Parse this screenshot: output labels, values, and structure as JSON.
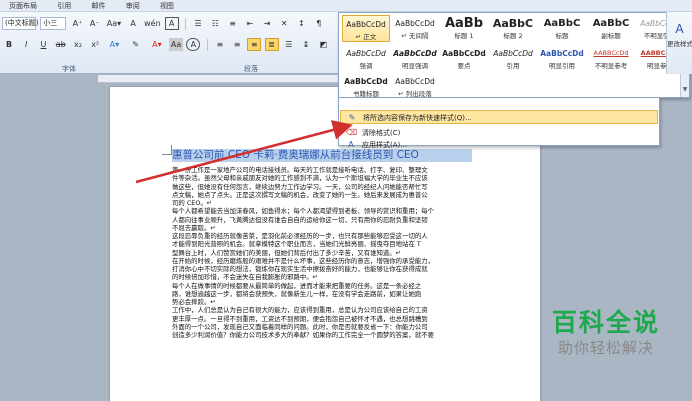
{
  "menubar": {
    "tabs": [
      "页面布局",
      "引用",
      "邮件",
      "审阅",
      "视图"
    ]
  },
  "ribbon": {
    "font_name": "(中文标题)",
    "font_size": "小三",
    "row1_icons": [
      "A⁺",
      "A⁻",
      "Aa▾",
      "A",
      "wén",
      "A"
    ],
    "row2_icons": [
      "ab",
      "A▾",
      "A▾",
      "Aa",
      "A"
    ],
    "font_group_label": "字体",
    "paragraph_group_label": "段落"
  },
  "gallery": {
    "row1": [
      {
        "sample": "AaBbCcDd",
        "name": "↵ 正文"
      },
      {
        "sample": "AaBbCcDd",
        "name": "↵ 无间隔"
      },
      {
        "sample": "AaBb",
        "name": "标题 1"
      },
      {
        "sample": "AaBbC",
        "name": "标题 2"
      },
      {
        "sample": "AaBbC",
        "name": "标题"
      },
      {
        "sample": "AaBbC",
        "name": "副标题"
      },
      {
        "sample": "AaBbCcDd",
        "name": "不明显强调"
      }
    ],
    "row2": [
      {
        "sample": "AaBbCcDd",
        "name": "强调"
      },
      {
        "sample": "AaBbCcDd",
        "name": "明显强调"
      },
      {
        "sample": "AaBbCcDd",
        "name": "要点"
      },
      {
        "sample": "AaBbCcDd",
        "name": "引用"
      },
      {
        "sample": "AaBbCcDd",
        "name": "明显引用"
      },
      {
        "sample": "AABBCcDd",
        "name": "不明显参考"
      },
      {
        "sample": "AABBCcDd",
        "name": "明显参考"
      }
    ],
    "row3": [
      {
        "sample": "AaBbCcDd",
        "name": "书籍标题"
      },
      {
        "sample": "AaBbCcDd",
        "name": "↵ 列出段落"
      }
    ]
  },
  "menu": {
    "save_selection": "将所选内容保存为新快速样式(Q)...",
    "clear_format": "清除格式(C)",
    "apply_styles": "应用样式(A)..."
  },
  "right_panel": {
    "change_styles": "更改样式"
  },
  "document": {
    "title": "惠普公司前 CEO 卡莉·费奥瑞娜从前台接线员到 CEO",
    "lines": [
      "第一份工作是一家地产公司的电话接线员。每天的工作就是接听电话、打字、复印、整理文",
      "件等杂活。虽然父母和亲戚朋友对她的工作感到不满，认为一个斯坦福大学的毕业生不应该",
      "做这些，但她没有任何怨言，继续边努力工作边学习。一天，公司的经纪人问她能否帮忙写",
      "点文稿，她点了点头。正是这次撰写文稿的机会，改变了她的一生。她后来发展成为惠普公",
      "司的 CEO。↵",
      "每个人都希望能去当加沫春风，如鱼得水；每个人都渴望得到老板、领导的赏识和重用；每个",
      "人都向往事业顺升，飞黄腾达但没有谁会自自的运给你这一切，只有用你的忍耐负重和坚韧",
      "不屈去赢取。↵",
      "这段忍辱负重的经历就像苦菜，是羽化前必须经历的一步，也只有那些能够忍受这一切的人",
      "才能得到阳光普照的机会。就拿模特这个职业而言，当她们光鲜亮丽、摇曳夺目地站在 T",
      "型舞台上时，人们赞赏她们的美丽，但她们背后付出了多少辛苦，又有谁知道。↵",
      "在开始的时候，经历磨炼般的艰难并不是什么坏事，这些经历你的意志，增强你的承受能力，",
      "打消你心中不切实际的想法，锻炼你在现实生活中擦拨奋好的能力，也能够让你在获得成就",
      "的时候倍加珍惜，不会迷失在自我膨胀的邪路中。↵",
      "每个人在做事情的时候都要从最简单的做起，进而才能来把重要的任务。这是一条必经之",
      "路，谁想逾越这一步，都将会获预失，就像新生儿一样，在没有学会走路前，如果让她跑",
      "势必会摔跤。↵",
      "工作中，人们总是认为自己有很大的能力，应该得到重用，总是认为公司应该给自己的工资",
      "更丰厚一点。一旦得不到重用，工资达不到预期，便会抱怨自己被怀才不遇，也总想跳槽到",
      "外面的一个公司，发现自己又面临着同样的问题。此时，你是否就要反省一下：你能力公司",
      "创造多少利润价值？你能力公司技术多大的奉献？如果你的工作完全一个圆梦的答案，就不要"
    ]
  },
  "watermark": {
    "line1": "百科全说",
    "line2": "助你轻松解决"
  },
  "colors": {
    "ribbon_bg": "#dfe8f4",
    "title_highlight": "#b8d0ec",
    "title_text": "#2c56b4",
    "menu_hover": "#ffe7a2",
    "arrow": "#d32f2f",
    "watermark_green": "#1ea94d"
  }
}
